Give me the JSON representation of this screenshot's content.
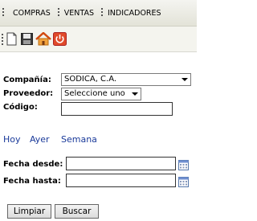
{
  "menu": {
    "items": [
      "COMPRAS",
      "VENTAS",
      "INDICADORES"
    ]
  },
  "toolbar": {
    "icons": [
      "new-document-icon",
      "save-icon",
      "home-icon",
      "power-icon"
    ]
  },
  "form": {
    "compania": {
      "label": "Compañía:",
      "value": "SODICA, C.A."
    },
    "proveedor": {
      "label": "Proveedor:",
      "value": "Seleccione uno"
    },
    "codigo": {
      "label": "Código:",
      "value": ""
    },
    "quick_ranges": [
      "Hoy",
      "Ayer",
      "Semana"
    ],
    "fecha_desde": {
      "label": "Fecha desde:",
      "value": ""
    },
    "fecha_hasta": {
      "label": "Fecha hasta:",
      "value": ""
    },
    "buttons": {
      "clear": "Limpiar",
      "search": "Buscar"
    }
  },
  "colors": {
    "link": "#1a3a9a",
    "menu_bg": "#ecece4",
    "toolbar_bg": "#f4f4ee"
  }
}
